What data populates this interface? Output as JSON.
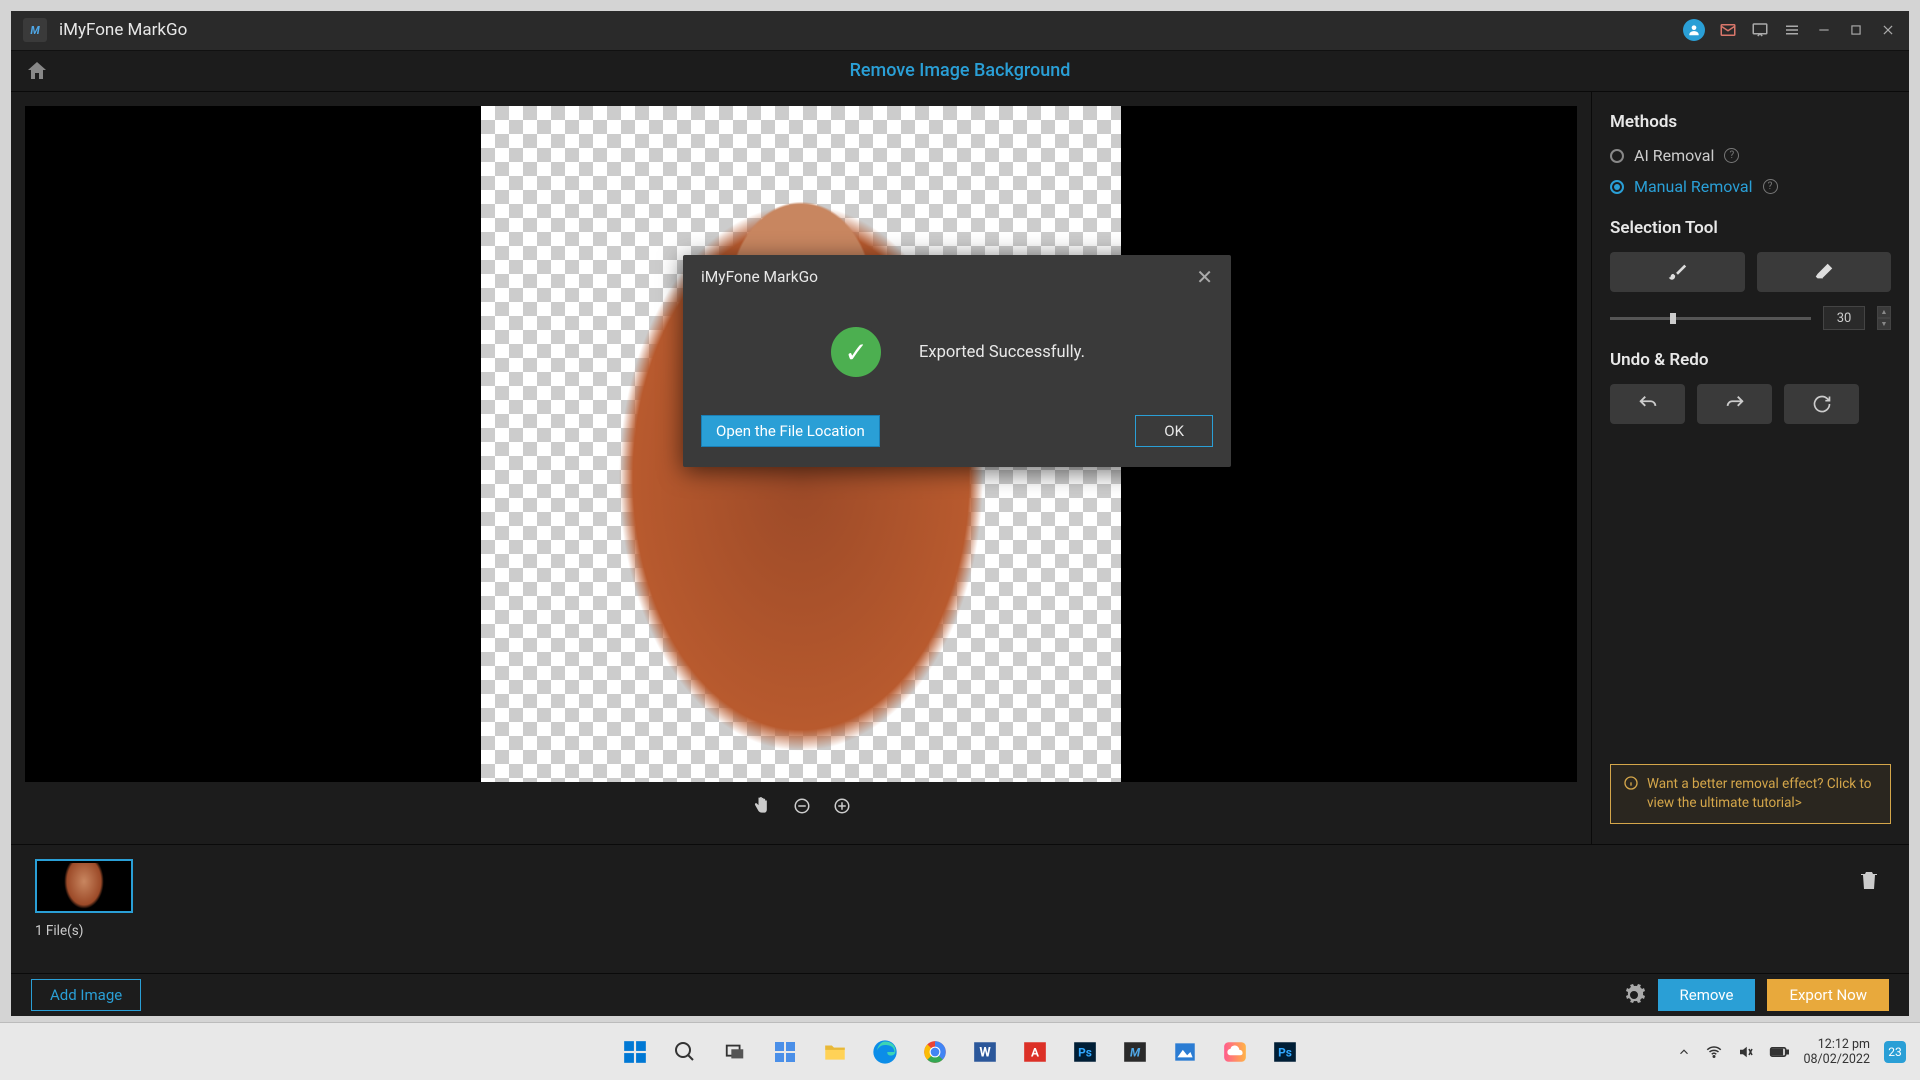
{
  "titlebar": {
    "app_name": "iMyFone MarkGo"
  },
  "header": {
    "page_title": "Remove Image Background"
  },
  "right_panel": {
    "methods_heading": "Methods",
    "ai_removal_label": "AI Removal",
    "manual_removal_label": "Manual Removal",
    "selection_tool_heading": "Selection Tool",
    "brush_size": "30",
    "undo_redo_heading": "Undo & Redo",
    "tip_text": "Want a better removal effect? Click to view the ultimate tutorial>"
  },
  "bottom": {
    "file_count": "1 File(s)",
    "add_image_label": "Add Image",
    "remove_label": "Remove",
    "export_label": "Export Now"
  },
  "modal": {
    "title": "iMyFone MarkGo",
    "message": "Exported Successfully.",
    "open_location_label": "Open the File Location",
    "ok_label": "OK"
  },
  "taskbar": {
    "time": "12:12 pm",
    "date": "08/02/2022",
    "notif_count": "23"
  }
}
